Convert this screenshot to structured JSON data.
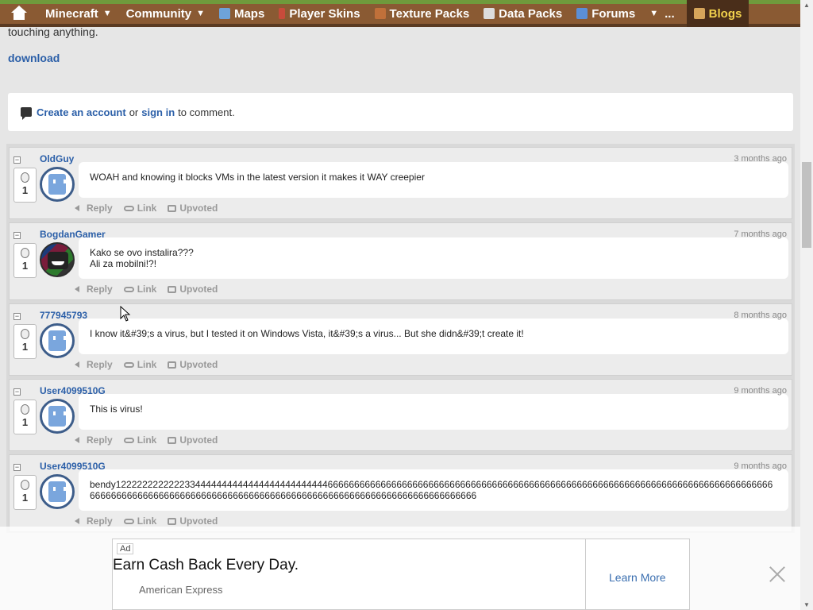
{
  "nav": {
    "items": [
      {
        "label": "Minecraft",
        "caret": true,
        "color": "#fff"
      },
      {
        "label": "Community",
        "caret": true,
        "color": "#fff"
      },
      {
        "label": "Maps",
        "icon": "map-icon",
        "color": "#6ea3d8"
      },
      {
        "label": "Player Skins",
        "icon": "skin-icon",
        "color": "#c84b3b"
      },
      {
        "label": "Texture Packs",
        "icon": "pickaxe-icon",
        "color": "#c0703a"
      },
      {
        "label": "Data Packs",
        "icon": "cube-icon",
        "color": "#ddd"
      },
      {
        "label": "Forums",
        "icon": "forum-icon",
        "color": "#5b8fd6"
      },
      {
        "label": "...",
        "caret_left": true
      },
      {
        "label": "Blogs",
        "icon": "book-icon",
        "color": "#d6a55b"
      }
    ]
  },
  "page": {
    "top_text": "touching anything.",
    "download": "download"
  },
  "comment_prompt": {
    "create_account": "Create an account",
    "or": "or",
    "sign_in": "sign in",
    "suffix": "to comment."
  },
  "actions": {
    "reply": "Reply",
    "link": "Link",
    "upvoted": "Upvoted"
  },
  "comments": [
    {
      "user": "OldGuy",
      "time": "3 months ago",
      "votes": "1",
      "avatar": "default",
      "text": "WOAH and knowing it blocks VMs in the latest version it makes it WAY creepier"
    },
    {
      "user": "BogdanGamer",
      "time": "7 months ago",
      "votes": "1",
      "avatar": "custom",
      "text": "Kako se ovo instalira???",
      "text2": "Ali za mobilni!?!"
    },
    {
      "user": "777945793",
      "time": "8 months ago",
      "votes": "1",
      "avatar": "default",
      "text": "I know it&#39;s a virus, but I tested it on Windows Vista, it&#39;s a virus... But she didn&#39;t create it!"
    },
    {
      "user": "User4099510G",
      "time": "9 months ago",
      "votes": "1",
      "avatar": "default",
      "text": "Тhis is virus!"
    },
    {
      "user": "User4099510G",
      "time": "9 months ago",
      "votes": "1",
      "avatar": "default",
      "text": "bendy12222222222223344444444444444444444444446666666666666666666666666666666666666666666666666666666666666666666666666666666666666666666666666666666666666666666666666666666666666666666666666666666666666"
    }
  ],
  "ad": {
    "tag": "Ad",
    "headline": "Earn Cash Back Every Day.",
    "advertiser": "American Express",
    "cta": "Learn More"
  }
}
